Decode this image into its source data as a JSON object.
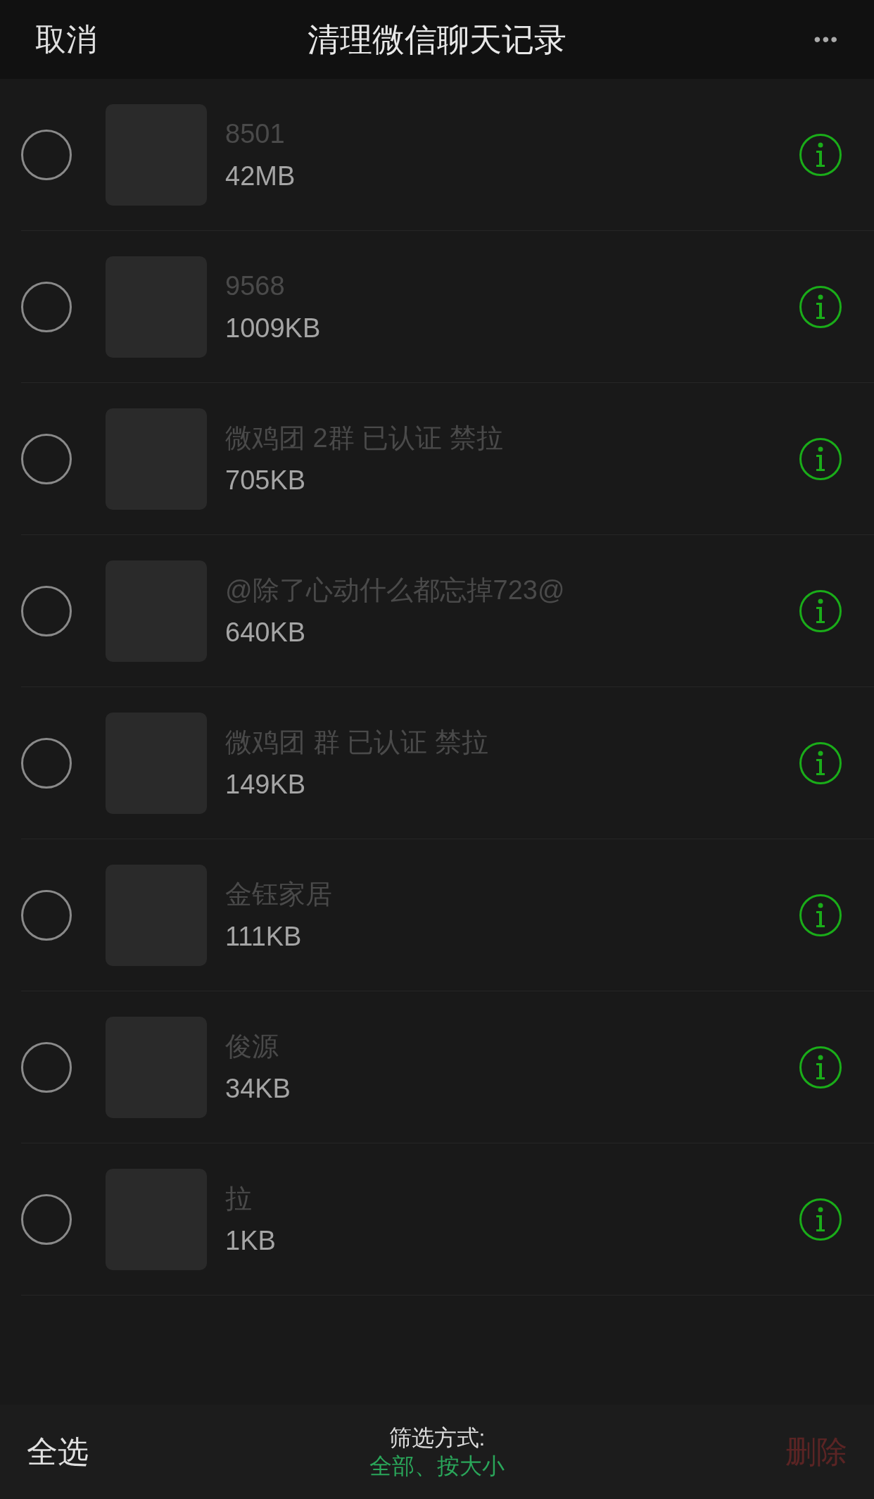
{
  "header": {
    "cancel": "取消",
    "title": "清理微信聊天记录",
    "more": "•••"
  },
  "chats": [
    {
      "name": "8501",
      "size": "42MB",
      "selected": false
    },
    {
      "name": "9568",
      "size": "1009KB",
      "selected": false
    },
    {
      "name": "微鸡团 2群 已认证 禁拉",
      "size": "705KB",
      "selected": false
    },
    {
      "name": "@除了心动什么都忘掉723@",
      "size": "640KB",
      "selected": false
    },
    {
      "name": "微鸡团 群 已认证 禁拉",
      "size": "149KB",
      "selected": false
    },
    {
      "name": "金钰家居",
      "size": "111KB",
      "selected": false
    },
    {
      "name": "俊源",
      "size": "34KB",
      "selected": false
    },
    {
      "name": "拉",
      "size": "1KB",
      "selected": false
    }
  ],
  "footer": {
    "select_all": "全选",
    "filter_label": "筛选方式:",
    "filter_value": "全部、按大小",
    "delete": {
      "label": "删除",
      "disabled": true
    }
  }
}
